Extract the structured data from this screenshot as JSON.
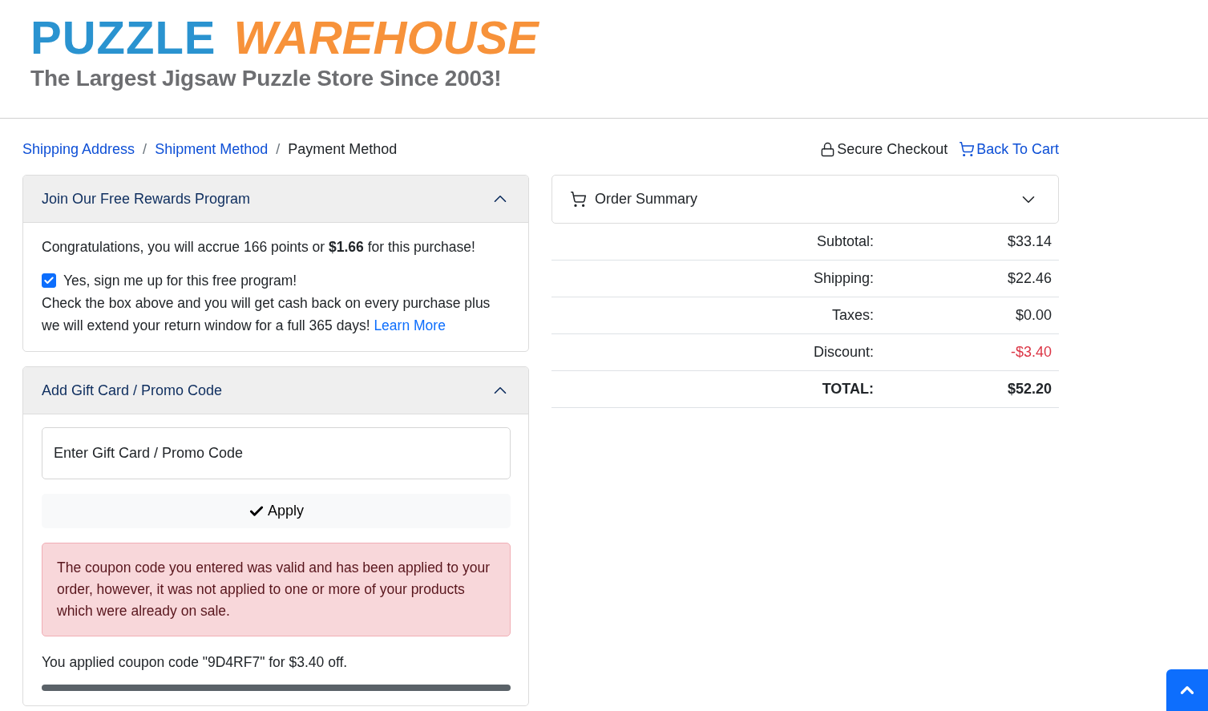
{
  "logo": {
    "brand_first": "PUZZLE",
    "brand_second": "WAREHOUSE",
    "tagline": "The Largest Jigsaw Puzzle Store Since 2003!"
  },
  "breadcrumbs": [
    {
      "label": "Shipping Address",
      "kind": "link"
    },
    {
      "label": "Shipment Method",
      "kind": "link"
    },
    {
      "label": "Payment Method",
      "kind": "current"
    }
  ],
  "separator": "/",
  "top_links": [
    {
      "label": "Secure Checkout",
      "kind": "lock"
    },
    {
      "label": "Back To Cart",
      "kind": "cart"
    }
  ],
  "rewards": {
    "title": "Join Our Free Rewards Program",
    "expanded": true,
    "message": "Congratulations, you will accrue 166 points or **$1.66** for this purchase!",
    "checkbox": {
      "label": "Yes, sign me up for this free program!",
      "checked": true
    },
    "description": "Check the box above and you will get cash back on every purchase plus we will extend your return window for a full 365 days!",
    "link": "Learn More"
  },
  "promo": {
    "title": "Add Gift Card / Promo Code",
    "expanded": true,
    "placeholder": "Enter Gift Card / Promo Code",
    "apply": "Apply",
    "alert": "The coupon code you entered was valid and has been applied to your order, however, it was not applied to one or more of your products which were already on sale.",
    "applied": "You applied coupon code \"9D4RF7\" for $3.40 off."
  },
  "summary": {
    "title": "Order Summary",
    "expanded": false,
    "rows": [
      {
        "label": "Subtotal:",
        "value": "$33.14",
        "kind": "normal"
      },
      {
        "label": "Shipping:",
        "value": "$22.46",
        "kind": "normal"
      },
      {
        "label": "Taxes:",
        "value": "$0.00",
        "kind": "normal"
      },
      {
        "label": "Discount:",
        "value": "-$3.40",
        "kind": "discount"
      },
      {
        "label": "TOTAL:",
        "value": "$52.20",
        "kind": "total"
      }
    ]
  }
}
